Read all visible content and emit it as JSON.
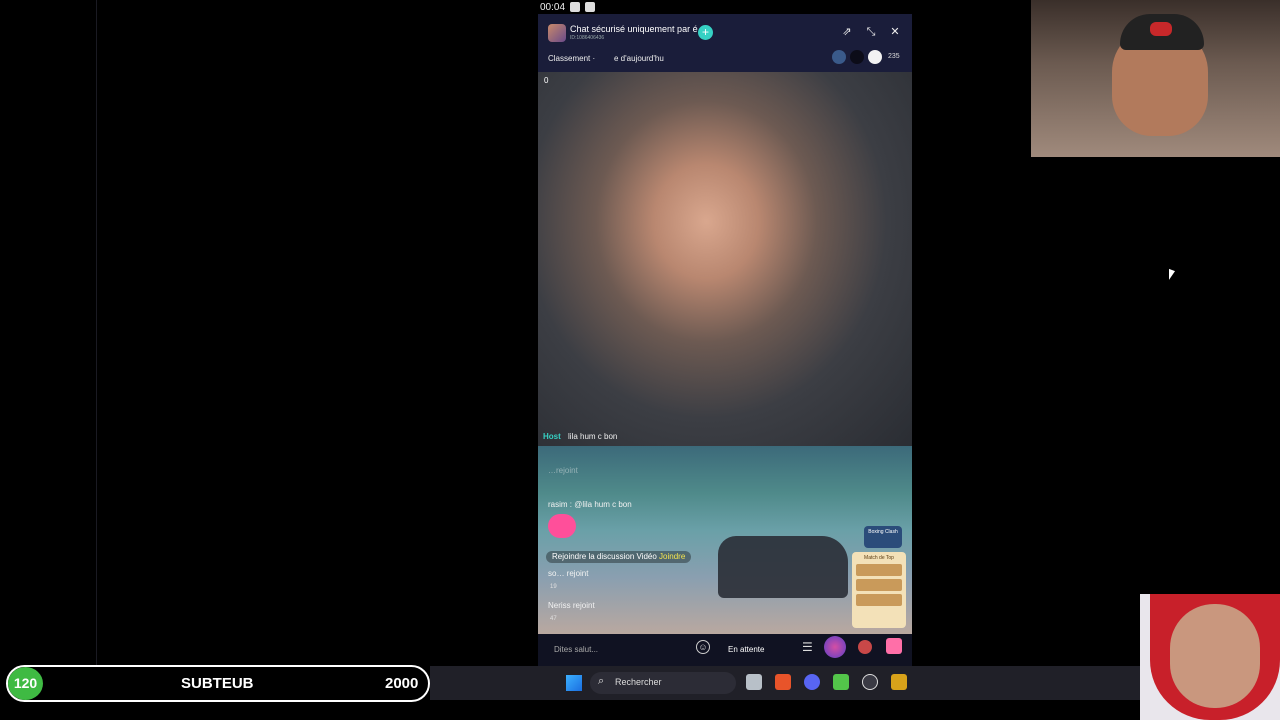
{
  "system": {
    "clock": "00:04"
  },
  "room": {
    "title": "Chat sécurisé uniquement par é",
    "id_text": "ID:1086406436",
    "ranking": "Classement ·",
    "today": "e d'aujourd'hu",
    "viewer_count": "235",
    "coins": "0",
    "host_tag": "Host",
    "host_message": "lila hum c bon"
  },
  "chat": {
    "faded_line": "…rejoint",
    "rasim_message": "rasim : @lila hum c bon",
    "join_video": "Rejoindre la discussion Vidéo",
    "join_tag": "Joindre",
    "user1": "so…  rejoint",
    "user1_count": "19",
    "user2": "Neriss rejoint",
    "user2_count": "47"
  },
  "widgets": {
    "boxing": "Boxing Clash",
    "match": "Match de Top"
  },
  "bottom_bar": {
    "placeholder": "Dites salut...",
    "wait_label": "En attente"
  },
  "sub_goal": {
    "current": "120",
    "label": "SUBTEUB",
    "target": "2000"
  },
  "taskbar": {
    "search_label": "Rechercher"
  }
}
